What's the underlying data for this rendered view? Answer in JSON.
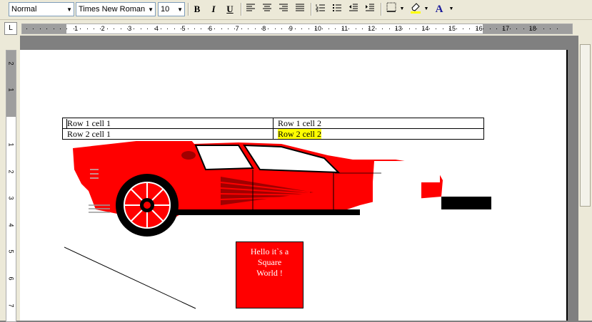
{
  "toolbar": {
    "style": "Normal",
    "font": "Times New Roman",
    "size": "10",
    "bold_label": "B",
    "italic_label": "I",
    "underline_label": "U",
    "font_color_label": "A"
  },
  "ruler": {
    "tab_selector": "L",
    "numbers": [
      "1",
      "2",
      "3",
      "4",
      "5",
      "6",
      "7",
      "8",
      "9",
      "10",
      "11",
      "12",
      "13",
      "14",
      "15",
      "16",
      "17",
      "18"
    ],
    "left_numbers": [
      "2",
      "1",
      "1",
      "2",
      "3",
      "4",
      "5",
      "6",
      "7"
    ]
  },
  "document": {
    "table": [
      [
        "Row 1 cell 1",
        "Row 1 cell 2"
      ],
      [
        "Row 2 cell 1",
        "Row 2 cell 2"
      ]
    ],
    "box_text": [
      "Hello it`s a",
      "Square",
      "World !"
    ]
  },
  "colors": {
    "car_body": "#ff0000",
    "highlight": "#ffff00"
  },
  "icons": [
    "align-left-icon",
    "align-center-icon",
    "align-right-icon",
    "justify-icon",
    "numbered-list-icon",
    "bullet-list-icon",
    "decrease-indent-icon",
    "increase-indent-icon",
    "border-icon",
    "highlight-icon",
    "font-color-icon"
  ]
}
